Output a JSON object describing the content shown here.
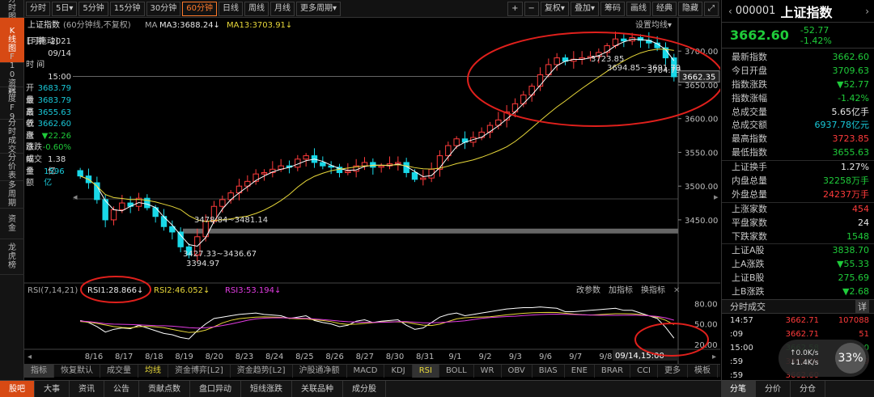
{
  "left_nav": [
    {
      "label": "分时图",
      "active": false
    },
    {
      "label": "K线图",
      "active": true
    },
    {
      "label": "F10资料",
      "active": false
    },
    {
      "label": "深度F9",
      "active": false
    },
    {
      "label": "分时成交",
      "active": false
    },
    {
      "label": "分价表",
      "active": false
    },
    {
      "label": "多周期",
      "active": false
    },
    {
      "label": "资金",
      "active": false
    },
    {
      "label": "龙虎榜",
      "active": false
    }
  ],
  "toolbar": {
    "periods": [
      "分时",
      "5日▾",
      "5分钟",
      "15分钟",
      "30分钟",
      "60分钟",
      "日线",
      "周线",
      "月线",
      "更多周期▾"
    ],
    "active_period": "60分钟",
    "tools": [
      "+",
      "−",
      "复权▾",
      "叠加▾",
      "筹码",
      "画线",
      "经典",
      "隐藏"
    ]
  },
  "chart": {
    "title": "上证指数",
    "subtitle": "(60分钟线,不复权)",
    "ma_label": "MA",
    "ma3": "MA3:3688.24↓",
    "ma13": "MA13:3703.91↓",
    "settings_link": "设置均线▾",
    "drag_label": "[可拖动]",
    "annotations": {
      "high": "3723.85",
      "high_right": "3704.79",
      "mid": "3694.85~3691.79",
      "m1": "3478.84~3481.14",
      "m2": "3427.33~3436.67",
      "low": "3394.97"
    },
    "current_label": "3662.35",
    "cursor_time": "09/14,15:00"
  },
  "info_panel": [
    {
      "k": "日 期",
      "v": "2021"
    },
    {
      "k": "",
      "v": "09/14"
    },
    {
      "k": "时 间",
      "v": ""
    },
    {
      "k": "",
      "v": "15:00"
    },
    {
      "k": "开 盘",
      "v": "3683.79"
    },
    {
      "k": "最 高",
      "v": "3683.79"
    },
    {
      "k": "最 低",
      "v": "3655.63"
    },
    {
      "k": "收 盘",
      "v": "3662.60"
    },
    {
      "k": "涨 跌",
      "v": "▼22.26"
    },
    {
      "k": "涨跌幅",
      "v": "-0.60%"
    },
    {
      "k": "成交量",
      "v": "1.38亿"
    },
    {
      "k": "金 额",
      "v": "1596亿"
    }
  ],
  "rsi": {
    "label": "RSI(7,14,21)",
    "rsi1": "RSI1:28.866↓",
    "rsi2": "RSI2:46.052↓",
    "rsi3": "RSI3:53.194↓",
    "links": [
      "改参数",
      "加指标",
      "换指标"
    ],
    "ticks": [
      "80.00",
      "50.00",
      "20.00"
    ]
  },
  "chart_data": {
    "type": "candlestick",
    "dates": [
      "8/16",
      "8/17",
      "8/18",
      "8/19",
      "8/20",
      "8/23",
      "8/24",
      "8/25",
      "8/26",
      "8/27",
      "8/30",
      "8/31",
      "9/1",
      "9/2",
      "9/3",
      "9/6",
      "9/7",
      "9/8",
      "9/9",
      "9/10"
    ],
    "y_ticks": [
      "3700.00",
      "3650.00",
      "3600.00",
      "3550.00",
      "3500.00",
      "3450.00"
    ],
    "ylim": [
      3390,
      3735
    ],
    "closes": [
      3515,
      3505,
      3480,
      3450,
      3465,
      3475,
      3470,
      3482,
      3468,
      3455,
      3440,
      3432,
      3410,
      3398,
      3425,
      3448,
      3470,
      3480,
      3490,
      3500,
      3507,
      3518,
      3520,
      3525,
      3530,
      3528,
      3540,
      3545,
      3535,
      3530,
      3528,
      3520,
      3522,
      3530,
      3535,
      3528,
      3530,
      3533,
      3535,
      3520,
      3510,
      3512,
      3525,
      3545,
      3560,
      3570,
      3565,
      3572,
      3580,
      3590,
      3598,
      3610,
      3622,
      3635,
      3648,
      3665,
      3680,
      3690,
      3685,
      3688,
      3690,
      3692,
      3698,
      3708,
      3718,
      3715,
      3720,
      3716,
      3712,
      3705,
      3690,
      3662
    ],
    "rsi1": [
      55,
      52,
      46,
      38,
      42,
      44,
      43,
      48,
      44,
      40,
      36,
      34,
      30,
      28,
      40,
      50,
      58,
      60,
      62,
      64,
      65,
      66,
      64,
      63,
      62,
      58,
      60,
      62,
      55,
      52,
      50,
      46,
      48,
      54,
      56,
      52,
      54,
      55,
      56,
      48,
      42,
      44,
      52,
      60,
      64,
      66,
      62,
      64,
      66,
      68,
      70,
      72,
      73,
      74,
      74,
      75,
      74,
      73,
      68,
      68,
      69,
      70,
      71,
      72,
      73,
      70,
      70,
      66,
      62,
      58,
      45,
      29
    ]
  },
  "bottom_tabs": [
    "指标",
    "恢复默认",
    "成交量",
    "均线",
    "资金博弈[L2]",
    "资金趋势[L2]",
    "沪股通净额",
    "MACD",
    "KDJ",
    "RSI",
    "BOLL",
    "WR",
    "OBV",
    "BIAS",
    "ENE",
    "BRAR",
    "CCI",
    "更多",
    "模板"
  ],
  "active_tab": "RSI",
  "footer_tabs": [
    "股吧",
    "大事",
    "资讯",
    "公告",
    "贡献点数",
    "盘口异动",
    "短线涨跌",
    "关联品种",
    "成分股"
  ],
  "quote": {
    "code": "000001",
    "name": "上证指数",
    "price": "3662.60",
    "change": "-52.77",
    "pct": "-1.42%",
    "rows": [
      {
        "k": "最新指数",
        "v": "3662.60",
        "c": "grn"
      },
      {
        "k": "今日开盘",
        "v": "3709.63",
        "c": "grn"
      },
      {
        "k": "指数涨跌",
        "v": "▼52.77",
        "c": "grn"
      },
      {
        "k": "指数涨幅",
        "v": "-1.42%",
        "c": "grn"
      },
      {
        "k": "总成交量",
        "v": "5.65亿手",
        "c": "wht"
      },
      {
        "k": "总成交额",
        "v": "6937.78亿元",
        "c": "cy"
      },
      {
        "k": "最高指数",
        "v": "3723.85",
        "c": "red"
      },
      {
        "k": "最低指数",
        "v": "3655.63",
        "c": "grn"
      }
    ],
    "rows2": [
      {
        "k": "上证换手",
        "v": "1.27%",
        "c": "wht"
      },
      {
        "k": "内盘总量",
        "v": "32258万手",
        "c": "grn"
      },
      {
        "k": "外盘总量",
        "v": "24237万手",
        "c": "red"
      }
    ],
    "rows3": [
      {
        "k": "上涨家数",
        "v": "454",
        "c": "red"
      },
      {
        "k": "平盘家数",
        "v": "24",
        "c": "wht"
      },
      {
        "k": "下跌家数",
        "v": "1548",
        "c": "grn"
      }
    ],
    "rows4": [
      {
        "k": "上证A股",
        "v": "3838.70",
        "c": "grn"
      },
      {
        "k": "上A涨跌",
        "v": "▼55.33",
        "c": "grn"
      },
      {
        "k": "上证B股",
        "v": "275.69",
        "c": "grn"
      },
      {
        "k": "上B涨跌",
        "v": "▼2.68",
        "c": "grn"
      }
    ],
    "ticks_title": "分时成交",
    "ticks_more": "详",
    "ticks": [
      {
        "t": "14:57",
        "p": "3662.71",
        "v": "107088",
        "c": "red"
      },
      {
        "t": ":09",
        "p": "3662.71",
        "v": "51",
        "c": "red"
      },
      {
        "t": "15:00",
        "p": "3662.58",
        "v": "9000",
        "c": "grn"
      },
      {
        "t": ":59",
        "p": "3662.60",
        "v": "64689",
        "c": "red"
      },
      {
        "t": ":59",
        "p": "3662.60",
        "v": "",
        "c": "red"
      }
    ],
    "speed": {
      "pct": "33%",
      "up": "0.0K/s",
      "down": "1.4K/s"
    },
    "bottom": [
      "分笔",
      "分价",
      "分仓"
    ]
  }
}
